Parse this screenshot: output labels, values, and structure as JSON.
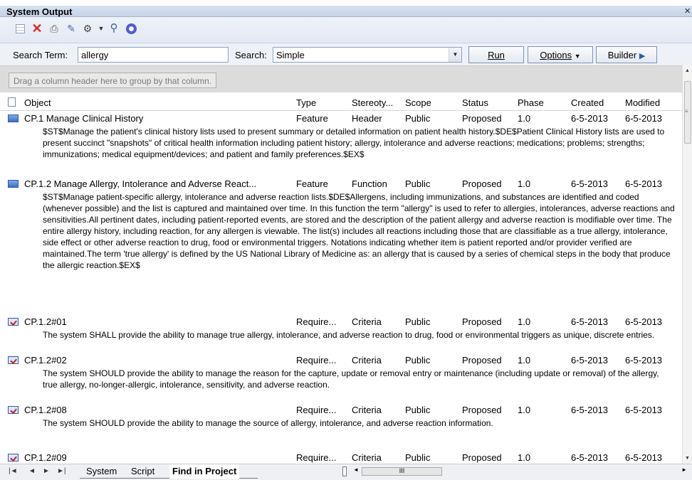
{
  "window": {
    "title": "System Output",
    "close_glyph": "×"
  },
  "toolbar": {
    "icons": [
      "grid-icon",
      "delete-icon",
      "print-icon",
      "edit-icon",
      "find-icon",
      "dropdown-arrow-icon",
      "search-icon",
      "help-icon"
    ]
  },
  "search": {
    "term_label": "Search Term:",
    "term_value": "allergy",
    "type_label": "Search:",
    "type_value": "Simple",
    "run_label": "Run",
    "options_label": "Options",
    "builder_label": "Builder"
  },
  "group_hint": "Drag a column header here to group by that column.",
  "columns": [
    "Object",
    "Type",
    "Stereoty...",
    "Scope",
    "Status",
    "Phase",
    "Created",
    "Modified"
  ],
  "rows": [
    {
      "icon": "feature-icon",
      "object": "CP.1 Manage Clinical History",
      "type": "Feature",
      "stereotype": "Header",
      "scope": "Public",
      "status": "Proposed",
      "phase": "1.0",
      "created": "6-5-2013",
      "modified": "6-5-2013",
      "notes": "$ST$Manage the patient's clinical history lists used to present summary or detailed information on patient health history.$DE$Patient Clinical History lists are used to present succinct \"snapshots\" of critical health information including patient history; allergy, intolerance and adverse reactions; medications; problems; strengths; immunizations; medical equipment/devices; and patient and family preferences.$EX$"
    },
    {
      "icon": "feature-icon",
      "object": "CP.1.2 Manage Allergy, Intolerance and Adverse React...",
      "type": "Feature",
      "stereotype": "Function",
      "scope": "Public",
      "status": "Proposed",
      "phase": "1.0",
      "created": "6-5-2013",
      "modified": "6-5-2013",
      "notes": "$ST$Manage patient-specific allergy, intolerance and adverse reaction lists.$DE$Allergens, including immunizations, and substances are identified and coded (whenever possible) and the list is captured and maintained over time. In this function the term \"allergy\" is used to refer to allergies, intolerances, adverse reactions and sensitivities.All pertinent dates, including patient-reported events, are stored and the description of the patient allergy and adverse reaction is modifiable over time. The entire allergy history, including reaction, for any allergen is viewable. The list(s) includes all reactions including those that are classifiable as a true allergy, intolerance, side effect or other adverse reaction to drug, food or environmental triggers. Notations indicating whether item is patient reported and/or provider verified are maintained.The term 'true allergy' is defined by the US National Library of Medicine as: an allergy that is caused by a series of chemical steps in the body that produce the allergic reaction.$EX$"
    },
    {
      "icon": "requirement-icon",
      "object": "CP.1.2#01",
      "type": "Require...",
      "stereotype": "Criteria",
      "scope": "Public",
      "status": "Proposed",
      "phase": "1.0",
      "created": "6-5-2013",
      "modified": "6-5-2013",
      "notes": "The system SHALL provide the ability to manage true allergy, intolerance, and adverse reaction to drug, food or environmental triggers as unique, discrete entries."
    },
    {
      "icon": "requirement-icon",
      "object": "CP.1.2#02",
      "type": "Require...",
      "stereotype": "Criteria",
      "scope": "Public",
      "status": "Proposed",
      "phase": "1.0",
      "created": "6-5-2013",
      "modified": "6-5-2013",
      "notes": "The system SHOULD provide the ability to manage the reason for the capture, update or removal entry or maintenance (including update or removal) of the allergy, true allergy, no-longer-allergic, intolerance, sensitivity, and adverse reaction."
    },
    {
      "icon": "requirement-icon",
      "object": "CP.1.2#08",
      "type": "Require...",
      "stereotype": "Criteria",
      "scope": "Public",
      "status": "Proposed",
      "phase": "1.0",
      "created": "6-5-2013",
      "modified": "6-5-2013",
      "notes": "The system SHOULD provide the ability to manage the source of allergy, intolerance, and adverse reaction information."
    },
    {
      "icon": "requirement-icon",
      "object": "CP.1.2#09",
      "type": "Require...",
      "stereotype": "Criteria",
      "scope": "Public",
      "status": "Proposed",
      "phase": "1.0",
      "created": "6-5-2013",
      "modified": "6-5-2013",
      "notes": ""
    }
  ],
  "bottom": {
    "nav_first": "|◄",
    "nav_prev": "◄",
    "nav_next": "►",
    "nav_last": "►|",
    "tabs": [
      "System",
      "Script",
      "Find in Project"
    ],
    "active_tab": "Find in Project",
    "hscroll_grip": "III"
  }
}
